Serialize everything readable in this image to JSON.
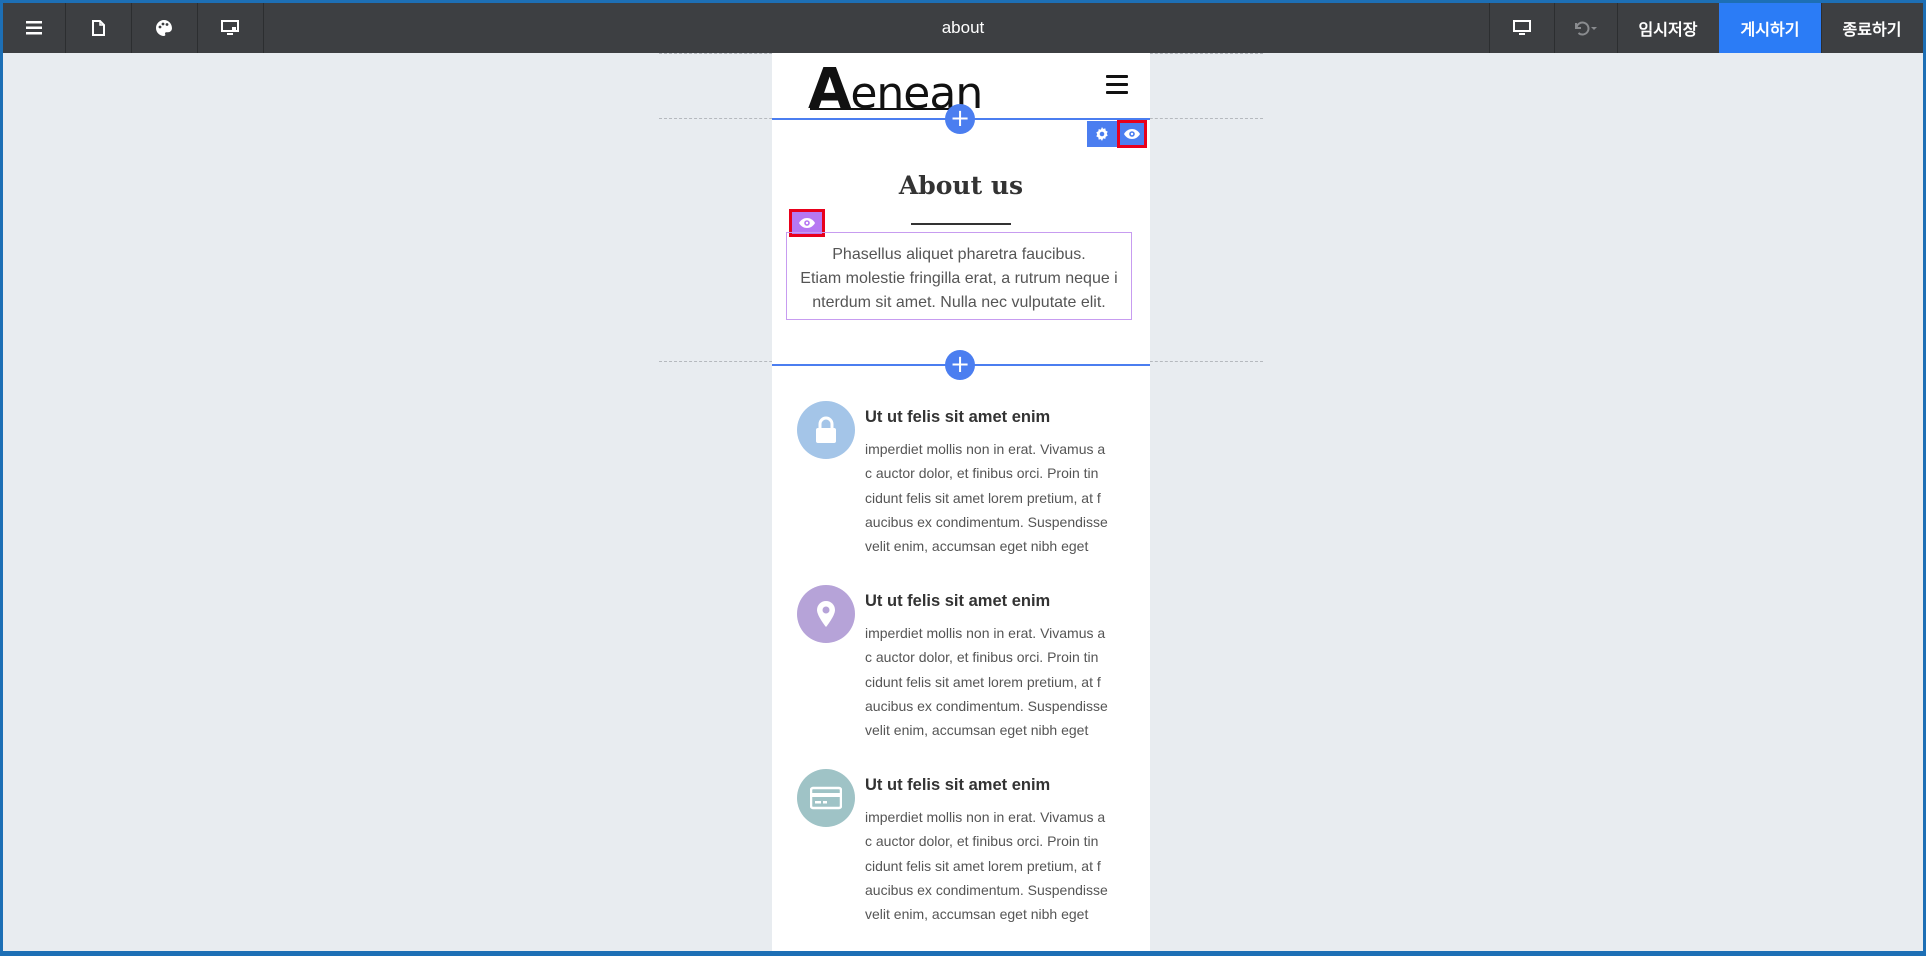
{
  "toolbar": {
    "page_title": "about",
    "temp_save_label": "임시저장",
    "publish_label": "게시하기",
    "exit_label": "종료하기",
    "icons": [
      "menu-icon",
      "page-icon",
      "palette-icon",
      "display-settings-icon",
      "desktop-view-icon",
      "undo-icon"
    ]
  },
  "site": {
    "logo_first": "A",
    "logo_rest": "enean"
  },
  "about": {
    "title": "About us",
    "text_lines": [
      "Phasellus aliquet pharetra faucibus.",
      "Etiam molestie fringilla erat, a rutrum neque i",
      "nterdum sit amet. Nulla nec vulputate elit."
    ]
  },
  "features": [
    {
      "icon": "lock-icon",
      "color": "#a4c5e8",
      "title": "Ut ut felis sit amet enim",
      "lines": [
        "imperdiet mollis non in erat. Vivamus a",
        "c auctor dolor, et finibus orci. Proin tin",
        "cidunt felis sit amet lorem pretium, at f",
        "aucibus ex condimentum. Suspendisse",
        "velit enim, accumsan eget nibh eget"
      ]
    },
    {
      "icon": "map-pin-icon",
      "color": "#b6a3d8",
      "title": "Ut ut felis sit amet enim",
      "lines": [
        "imperdiet mollis non in erat. Vivamus a",
        "c auctor dolor, et finibus orci. Proin tin",
        "cidunt felis sit amet lorem pretium, at f",
        "aucibus ex condimentum. Suspendisse",
        "velit enim, accumsan eget nibh eget"
      ]
    },
    {
      "icon": "credit-card-icon",
      "color": "#9fc3c6",
      "title": "Ut ut felis sit amet enim",
      "lines": [
        "imperdiet mollis non in erat. Vivamus a",
        "c auctor dolor, et finibus orci. Proin tin",
        "cidunt felis sit amet lorem pretium, at f",
        "aucibus ex condimentum. Suspendisse",
        "velit enim, accumsan eget nibh eget"
      ]
    }
  ],
  "colors": {
    "accent": "#4b7ef0",
    "publish": "#2b7cf6",
    "toolbar": "#3d3f42",
    "highlight": "#e8001c",
    "selection": "#c79cf0"
  }
}
